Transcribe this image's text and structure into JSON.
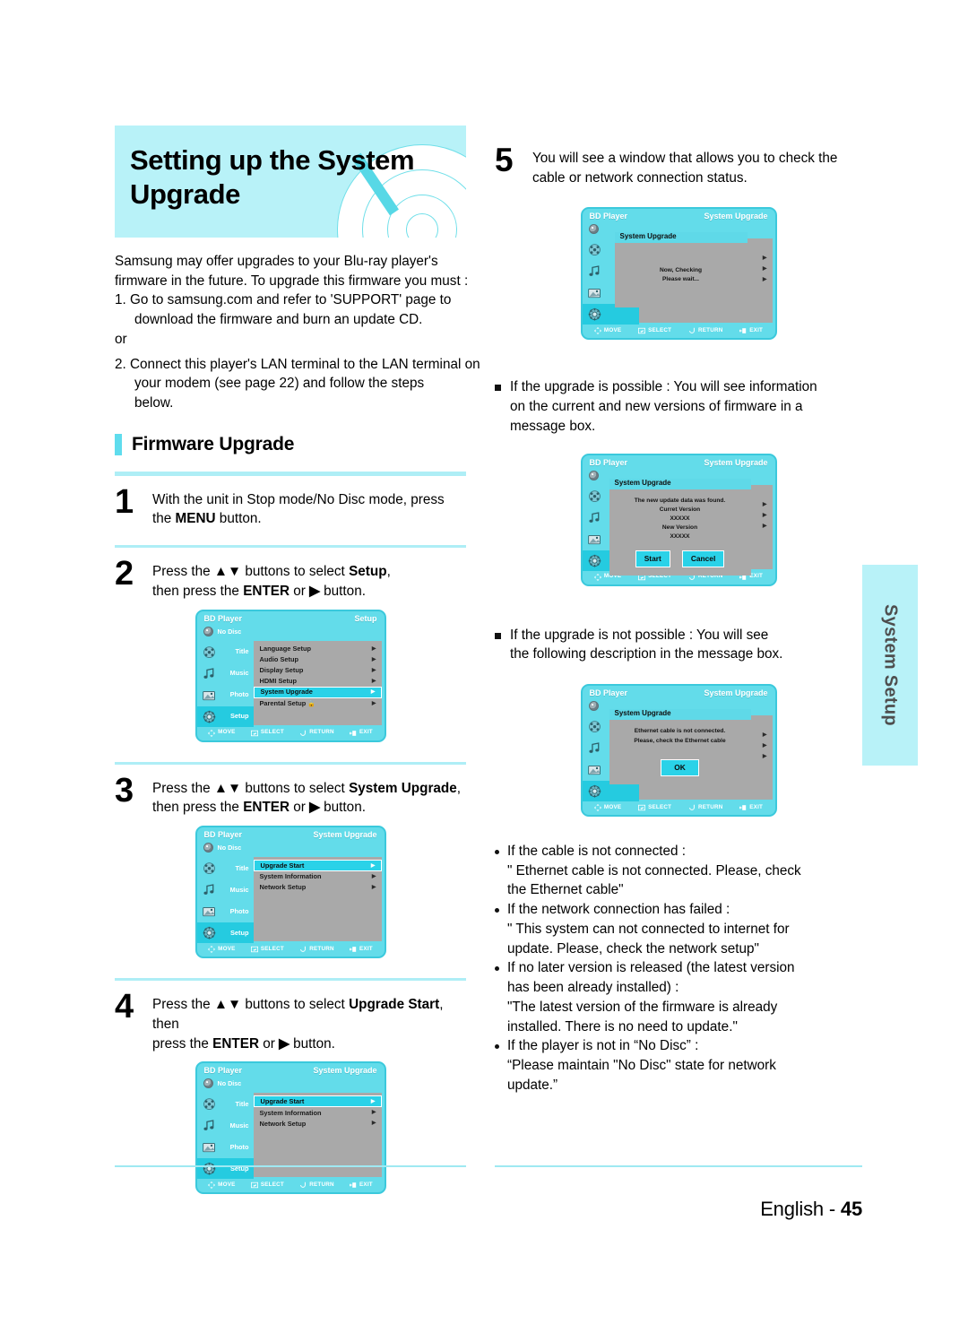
{
  "chapter": {
    "title_line1": "Setting up the System",
    "title_line2": "Upgrade"
  },
  "intro": {
    "line1": "Samsung may offer upgrades to your Blu-ray player's",
    "line2": "firmware in the future. To upgrade this firmware you must :",
    "item1": "1. Go to samsung.com and refer to 'SUPPORT' page to",
    "item1b": "download the firmware and burn an update CD.",
    "or": "or",
    "item2": "2. Connect this player's LAN terminal to the LAN terminal on",
    "item2b": "your modem (see page 22) and follow the steps below."
  },
  "section": {
    "heading": "Firmware Upgrade"
  },
  "steps": [
    {
      "num": "1",
      "text_a": "With the unit in Stop mode/No Disc mode, press the ",
      "bold_a": "MENU",
      "text_b": " button."
    },
    {
      "num": "2",
      "line1_a": "Press the ",
      "line1_arrows": "▲▼",
      "line1_b": " buttons to select ",
      "line1_bold": "Setup",
      "line1_c": ",",
      "line2_a": "then press the ",
      "line2_bold": "ENTER",
      "line2_b": " or ",
      "line2_arrow": "▶",
      "line2_c": " button."
    },
    {
      "num": "3",
      "line1_a": "Press the ",
      "line1_arrows": "▲▼",
      "line1_b": " buttons to select ",
      "line1_bold": "System Upgrade",
      "line1_c": ",",
      "line2_a": "then press the ",
      "line2_bold": "ENTER",
      "line2_b": " or ",
      "line2_arrow": "▶",
      "line2_c": " button."
    },
    {
      "num": "4",
      "line1_a": "Press the ",
      "line1_arrows": "▲▼",
      "line1_b": " buttons to select ",
      "line1_bold": "Upgrade Start",
      "line1_c": ", then",
      "line2_a": "press the ",
      "line2_bold": "ENTER",
      "line2_b": " or ",
      "line2_arrow": "▶",
      "line2_c": " button."
    },
    {
      "num": "5",
      "line1": "You will see a window that allows you to check the",
      "line2": "cable or network connection status."
    }
  ],
  "bullets": [
    {
      "line1": "If the upgrade is possible : You will see information",
      "line2": "on the current and new versions of firmware in a",
      "line3": "message box."
    },
    {
      "line1": "If the upgrade is not possible : You will see",
      "line2": "the following description in the message box.",
      "line3": ""
    }
  ],
  "dot_notes": [
    {
      "head": "If the cable is not connected :",
      "body1": "\" Ethernet cable is not connected. Please, check",
      "body2": "the Ethernet cable\"",
      "body3": ""
    },
    {
      "head": "If the network connection has failed :",
      "body1": "\" This system can not connected to internet for",
      "body2": "update. Please, check the network setup\"",
      "body3": ""
    },
    {
      "head": "If no later version is released (the latest version",
      "body1": "has been already installed) :",
      "body2": "\"The latest version of the firmware is already",
      "body3": "installed. There is no need to update.\""
    },
    {
      "head": "If the player is not in “No Disc” :",
      "body1": "“Please maintain \"No Disc\" state for network",
      "body2": "update.”",
      "body3": ""
    }
  ],
  "tv_common": {
    "brand": "BD Player",
    "no_disc": "No Disc",
    "side": [
      "Title",
      "Music",
      "Photo",
      "Setup"
    ],
    "footer": [
      "MOVE",
      "SELECT",
      "RETURN",
      "EXIT"
    ]
  },
  "tv_setup": {
    "header_right": "Setup",
    "menu": [
      {
        "label": "Language Setup",
        "selected": false
      },
      {
        "label": "Audio Setup",
        "selected": false
      },
      {
        "label": "Display Setup",
        "selected": false
      },
      {
        "label": "HDMI Setup",
        "selected": false
      },
      {
        "label": "System Upgrade",
        "selected": true
      },
      {
        "label": "Parental Setup",
        "selected": false,
        "lock": true
      }
    ]
  },
  "tv_sysupgrade": {
    "header_right": "System Upgrade",
    "menu": [
      {
        "label": "Upgrade Start",
        "selected": true
      },
      {
        "label": "System Information",
        "selected": false
      },
      {
        "label": "Network Setup",
        "selected": false
      }
    ]
  },
  "tv_dialog_checking": {
    "header_right": "System Upgrade",
    "title": "System Upgrade",
    "line1": "Now, Checking",
    "line2": "Please wait..."
  },
  "tv_dialog_found": {
    "header_right": "System Upgrade",
    "title": "System Upgrade",
    "line1": "The new update data was found.",
    "line2": "Curret Version",
    "line3": "XXXXX",
    "line4": "New Version",
    "line5": "XXXXX",
    "btn_start": "Start",
    "btn_cancel": "Cancel"
  },
  "tv_dialog_error": {
    "header_right": "System Upgrade",
    "title": "System Upgrade",
    "line1": "Ethernet cable is not connected.",
    "line2": "Please, check the Ethernet cable",
    "btn_ok": "OK"
  },
  "side_tab": {
    "label": "System Setup"
  },
  "footer": {
    "language": "English - ",
    "page": "45"
  },
  "colors": {
    "accent_cyan": "#63dcea",
    "banner_cyan": "#b8f2f8",
    "rule_cyan": "#aeeef6",
    "menu_gray": "#a9a9a9"
  }
}
